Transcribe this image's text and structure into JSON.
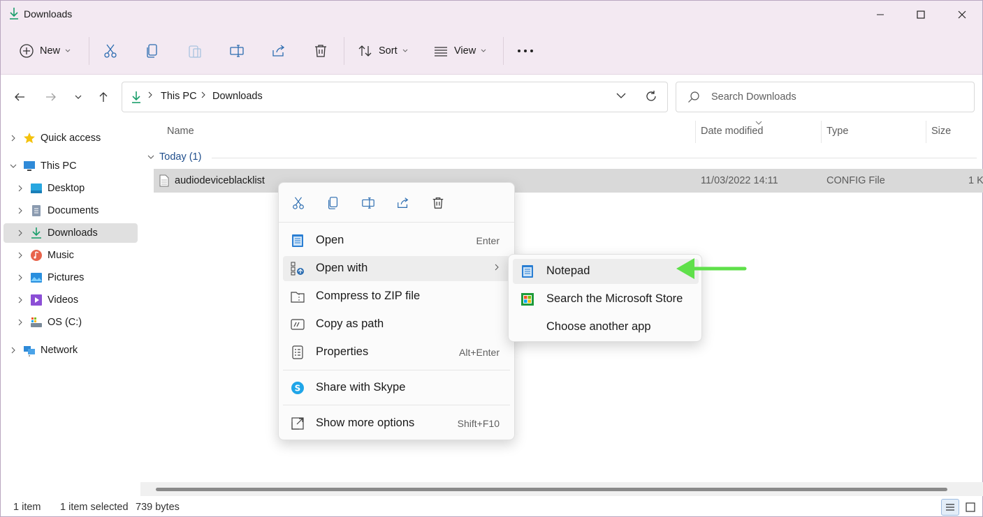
{
  "window": {
    "title": "Downloads",
    "controls": [
      "minimize-icon",
      "maximize-icon",
      "close-icon"
    ]
  },
  "toolbar": {
    "new_label": "New",
    "sort_label": "Sort",
    "view_label": "View",
    "icons": [
      "cut-icon",
      "copy-icon",
      "paste-icon",
      "rename-icon",
      "share-icon",
      "delete-icon",
      "more-icon"
    ]
  },
  "navigation": {
    "breadcrumb": [
      "This PC",
      "Downloads"
    ],
    "search_placeholder": "Search Downloads"
  },
  "sidebar": {
    "items": [
      {
        "label": "Quick access",
        "icon": "star-icon"
      },
      {
        "label": "This PC",
        "icon": "pc-icon"
      },
      {
        "label": "Desktop",
        "icon": "desktop-icon"
      },
      {
        "label": "Documents",
        "icon": "documents-icon"
      },
      {
        "label": "Downloads",
        "icon": "downloads-icon"
      },
      {
        "label": "Music",
        "icon": "music-icon"
      },
      {
        "label": "Pictures",
        "icon": "pictures-icon"
      },
      {
        "label": "Videos",
        "icon": "videos-icon"
      },
      {
        "label": "OS (C:)",
        "icon": "drive-icon"
      },
      {
        "label": "Network",
        "icon": "network-icon"
      }
    ]
  },
  "columns": {
    "name": "Name",
    "date": "Date modified",
    "type": "Type",
    "size": "Size"
  },
  "group": {
    "label": "Today (1)"
  },
  "files": [
    {
      "name": "audiodeviceblacklist",
      "date": "11/03/2022 14:11",
      "type": "CONFIG File",
      "size": "1 K"
    }
  ],
  "context_menu": {
    "quick_actions": [
      "cut-icon",
      "copy-icon",
      "rename-icon",
      "share-icon",
      "delete-icon"
    ],
    "items": [
      {
        "label": "Open",
        "shortcut": "Enter"
      },
      {
        "label": "Open with"
      },
      {
        "label": "Compress to ZIP file"
      },
      {
        "label": "Copy as path"
      },
      {
        "label": "Properties",
        "shortcut": "Alt+Enter"
      },
      {
        "label": "Share with Skype"
      },
      {
        "label": "Show more options",
        "shortcut": "Shift+F10"
      }
    ]
  },
  "submenu": {
    "items": [
      {
        "label": "Notepad"
      },
      {
        "label": "Search the Microsoft Store"
      },
      {
        "label": "Choose another app"
      }
    ]
  },
  "status": {
    "count": "1 item",
    "selected": "1 item selected",
    "size": "739 bytes"
  },
  "colors": {
    "accent_green": "#1a9e6b",
    "annotation_arrow": "#5fe04a",
    "title_bg": "#f3e9f2"
  }
}
